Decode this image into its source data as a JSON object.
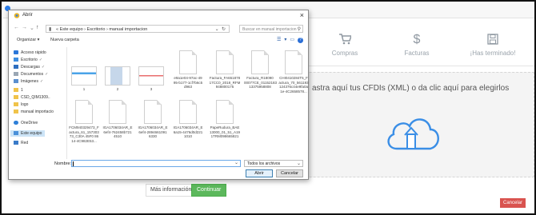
{
  "app": {
    "nav": [
      {
        "label": "Compras",
        "icon": "cart-icon"
      },
      {
        "label": "Facturas",
        "icon": "dollar-icon"
      },
      {
        "label": "¡Has terminado!",
        "icon": "save-icon"
      }
    ],
    "dropzone_text": "astra aquí tus CFDIs (XML) o da clic aquí para elegirlos",
    "more_info_label": "Más información",
    "continue_label": "Continuar",
    "cancel_label": "Cancelar"
  },
  "dialog": {
    "title": "Abrir",
    "breadcrumb": "« Este equipo  ›  Escritorio  ›  manual importacion",
    "search_placeholder": "Buscar en manual importacion",
    "organize_label": "Organizar ▾",
    "new_folder_label": "Nueva carpeta",
    "sidebar": [
      {
        "label": "Acceso rápido",
        "icon": "star-icon"
      },
      {
        "label": "Escritorio",
        "icon": "desktop-icon"
      },
      {
        "label": "Descargas",
        "icon": "download-icon"
      },
      {
        "label": "Documentos",
        "icon": "documents-icon"
      },
      {
        "label": "Imágenes",
        "icon": "pictures-icon"
      },
      {
        "label": "1",
        "icon": "folder-icon"
      },
      {
        "label": "CSD_QIM1309..",
        "icon": "folder-icon"
      },
      {
        "label": "logo",
        "icon": "folder-icon"
      },
      {
        "label": "manual importacio",
        "icon": "folder-icon"
      },
      {
        "label": "OneDrive",
        "icon": "cloud-icon"
      },
      {
        "label": "Este equipo",
        "icon": "computer-icon"
      },
      {
        "label": "Red",
        "icon": "network-icon"
      }
    ],
    "files": [
      {
        "name": "1"
      },
      {
        "name": "2"
      },
      {
        "name": "3"
      },
      {
        "name": "e9a1e04-97ac-49 95-b177-1cf7b6c5 d963"
      },
      {
        "name": "Factura_FA651878 17CC0_2018_RFM 948800175"
      },
      {
        "name": "Factura_R18090 00077CE_01152183 13375958808"
      },
      {
        "name": "CHI0410284T5_F actura_70_561193 124376c44e9fa0a 1e-4C2658578..."
      },
      {
        "name": "FCM940329473_F actura_61_157303 73_C30A 45F0 86 14-4C982E53..."
      },
      {
        "name": "IGA1706034AR_E 6ef4-762458b721 4510"
      },
      {
        "name": "IGA1706034AR_E 6ef4-2894661091 6330"
      },
      {
        "name": "IGA1706034AR_E 6a15-4476d0d221 1010"
      },
      {
        "name": "PapeRudura_BAE 13000_01_51_A19 1TRM098665821"
      }
    ],
    "filename_label": "Nombre:",
    "filename_value": "",
    "filter_value": "Todos los archivos",
    "open_label": "Abrir",
    "cancel_label": "Cancelar"
  }
}
